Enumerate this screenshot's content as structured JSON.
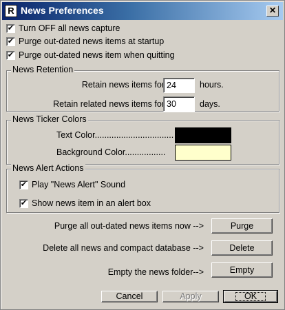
{
  "window": {
    "title": "News Preferences",
    "icon": "R"
  },
  "options": [
    {
      "label": "Turn OFF all news capture",
      "checked": true
    },
    {
      "label": "Purge out-dated news items at startup",
      "checked": true
    },
    {
      "label": "Purge out-dated news item when quitting",
      "checked": true
    }
  ],
  "retention": {
    "title": "News Retention",
    "retain_label": "Retain news items for",
    "retain_value": "24",
    "retain_unit": "hours.",
    "related_label": "Retain related news items for",
    "related_value": "30",
    "related_unit": "days."
  },
  "ticker": {
    "title": "News Ticker Colors",
    "text_color_label": "Text Color.................................",
    "text_color": "#000000",
    "bg_color_label": "Background Color.................",
    "bg_color": "#ffffcc"
  },
  "alerts": {
    "title": "News Alert Actions",
    "sound_label": "Play \"News Alert\" Sound",
    "sound_checked": true,
    "box_label": "Show news item in an alert box",
    "box_checked": true
  },
  "maintenance": {
    "purge_label": "Purge all out-dated news items now -->",
    "purge_button": "Purge",
    "delete_label": "Delete all news and compact database -->",
    "delete_button": "Delete",
    "empty_label": "Empty the news folder-->",
    "empty_button": "Empty"
  },
  "footer": {
    "cancel": "Cancel",
    "apply": "Apply",
    "ok": "OK"
  }
}
